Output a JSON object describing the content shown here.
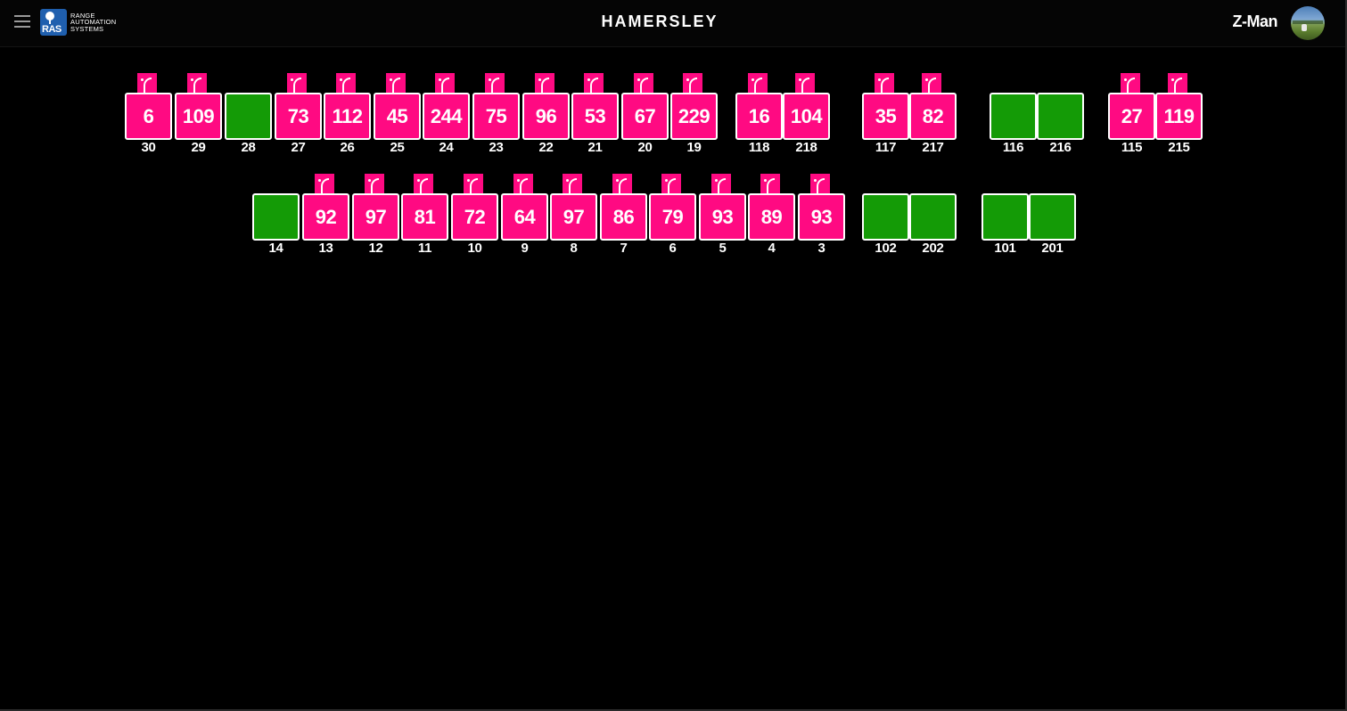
{
  "header": {
    "title": "HAMERSLEY",
    "username": "Z-Man",
    "logo": {
      "badge": "RAS",
      "words": [
        "RANGE",
        "AUTOMATION",
        "SYSTEMS"
      ]
    }
  },
  "colors": {
    "active_bay": "#ff0a82",
    "idle_bay": "#149b06",
    "background": "#000000"
  },
  "bays": [
    {
      "id": "30",
      "count": "6",
      "status": "active"
    },
    {
      "id": "29",
      "count": "109",
      "status": "active"
    },
    {
      "id": "28",
      "count": "",
      "status": "idle"
    },
    {
      "id": "27",
      "count": "73",
      "status": "active"
    },
    {
      "id": "26",
      "count": "112",
      "status": "active"
    },
    {
      "id": "25",
      "count": "45",
      "status": "active"
    },
    {
      "id": "24",
      "count": "244",
      "status": "active"
    },
    {
      "id": "23",
      "count": "75",
      "status": "active"
    },
    {
      "id": "22",
      "count": "96",
      "status": "active"
    },
    {
      "id": "21",
      "count": "53",
      "status": "active"
    },
    {
      "id": "20",
      "count": "67",
      "status": "active"
    },
    {
      "id": "19",
      "count": "229",
      "status": "active"
    },
    {
      "id": "118",
      "count": "16",
      "status": "active"
    },
    {
      "id": "218",
      "count": "104",
      "status": "active"
    },
    {
      "id": "117",
      "count": "35",
      "status": "active"
    },
    {
      "id": "217",
      "count": "82",
      "status": "active"
    },
    {
      "id": "116",
      "count": "",
      "status": "idle"
    },
    {
      "id": "216",
      "count": "",
      "status": "idle"
    },
    {
      "id": "115",
      "count": "27",
      "status": "active"
    },
    {
      "id": "215",
      "count": "119",
      "status": "active"
    },
    {
      "id": "14",
      "count": "",
      "status": "idle"
    },
    {
      "id": "13",
      "count": "92",
      "status": "active"
    },
    {
      "id": "12",
      "count": "97",
      "status": "active"
    },
    {
      "id": "11",
      "count": "81",
      "status": "active"
    },
    {
      "id": "10",
      "count": "72",
      "status": "active"
    },
    {
      "id": "9",
      "count": "64",
      "status": "active"
    },
    {
      "id": "8",
      "count": "97",
      "status": "active"
    },
    {
      "id": "7",
      "count": "86",
      "status": "active"
    },
    {
      "id": "6",
      "count": "79",
      "status": "active"
    },
    {
      "id": "5",
      "count": "93",
      "status": "active"
    },
    {
      "id": "4",
      "count": "89",
      "status": "active"
    },
    {
      "id": "3",
      "count": "93",
      "status": "active"
    },
    {
      "id": "102",
      "count": "",
      "status": "idle"
    },
    {
      "id": "202",
      "count": "",
      "status": "idle"
    },
    {
      "id": "101",
      "count": "",
      "status": "idle"
    },
    {
      "id": "201",
      "count": "",
      "status": "idle"
    }
  ]
}
